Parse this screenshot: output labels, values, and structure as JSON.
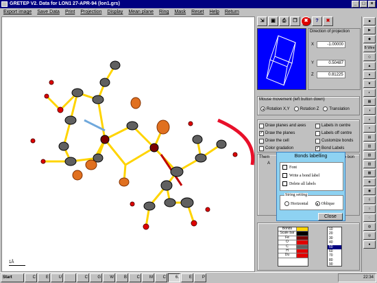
{
  "window": {
    "title": "GRETEP V2. Data for    LON1 27-APR-94 (lon1.grs)"
  },
  "menu": [
    "Export image",
    "Save Data",
    "Print",
    "Projection",
    "Display",
    "Mean plane",
    "Ring",
    "Mask",
    "Reset",
    "Help",
    "Return"
  ],
  "toolbar": [
    "",
    "",
    "",
    "",
    "✖",
    "?",
    "✖"
  ],
  "direction": {
    "title": "Direction of projection",
    "rows": [
      {
        "axis": "X",
        "value": "-1.00000"
      },
      {
        "axis": "Y",
        "value": "0.50487"
      },
      {
        "axis": "Z",
        "value": "0.81225"
      }
    ]
  },
  "mouse": {
    "title": "Mouse movement (left button down)",
    "options": [
      {
        "label": "Rotation X,Y",
        "selected": true
      },
      {
        "label": "Rotation Z",
        "selected": false
      },
      {
        "label": "Translation",
        "selected": false
      }
    ]
  },
  "display_options": [
    {
      "label": "Draw planes and axes",
      "checked": false
    },
    {
      "label": "Draw the planes",
      "checked": true
    },
    {
      "label": "Draw the cell",
      "checked": false
    },
    {
      "label": "Color gradation",
      "checked": false
    },
    {
      "label": "Labels in centre",
      "checked": false
    },
    {
      "label": "Labels off centre",
      "checked": false
    },
    {
      "label": "Customize bonds",
      "checked": false
    },
    {
      "label": "Bond Labels",
      "checked": true
    }
  ],
  "partial_texts": {
    "them": "Them",
    "ebon": "e bon",
    "a": "A"
  },
  "dialog": {
    "title": "Bonds labelling",
    "checks": [
      "Font",
      "Write a bond label",
      "Delete all labels"
    ],
    "string_title": "String setting",
    "string_options": [
      {
        "label": "Horizontal",
        "selected": false
      },
      {
        "label": "Oblique",
        "selected": true
      }
    ],
    "close": "Close"
  },
  "color_table": [
    {
      "label": "Bonds",
      "color": "#ffd400"
    },
    {
      "label": "Scale bar",
      "color": "#000000"
    },
    {
      "label": "Fe",
      "color": "#7a0000"
    },
    {
      "label": "O",
      "color": "#e00000"
    },
    {
      "label": "C",
      "color": "#606060"
    },
    {
      "label": "H",
      "color": "#e00000"
    },
    {
      "label": "Du",
      "color": "#e00000"
    }
  ],
  "number_list": {
    "items": [
      "10",
      "20",
      "30",
      "40",
      "50",
      "60",
      "70",
      "80",
      "90"
    ],
    "selected": "50"
  },
  "scale_label": "1Å",
  "side_buttons": [
    "",
    "",
    "",
    "B Wire",
    "",
    "",
    "",
    "",
    "",
    "",
    "",
    "",
    "",
    "",
    "",
    "",
    "",
    "",
    "",
    "",
    "",
    "",
    "",
    "",
    "",
    ""
  ],
  "taskbar": {
    "start": "Start",
    "tasks": [
      "C",
      "E",
      "U",
      "",
      "C",
      "G",
      "W",
      "B",
      "C",
      "M",
      "C",
      "6.",
      "E",
      "P"
    ],
    "clock": "22:34"
  },
  "colors": {
    "title": "#000080",
    "canvas": "#ffffff",
    "dialog": "#8ed2f2",
    "bond": "#ffd400",
    "oxygen": "#e00000",
    "iron": "#7a0000",
    "carbon": "#606060",
    "arrow": "#e8102a"
  }
}
